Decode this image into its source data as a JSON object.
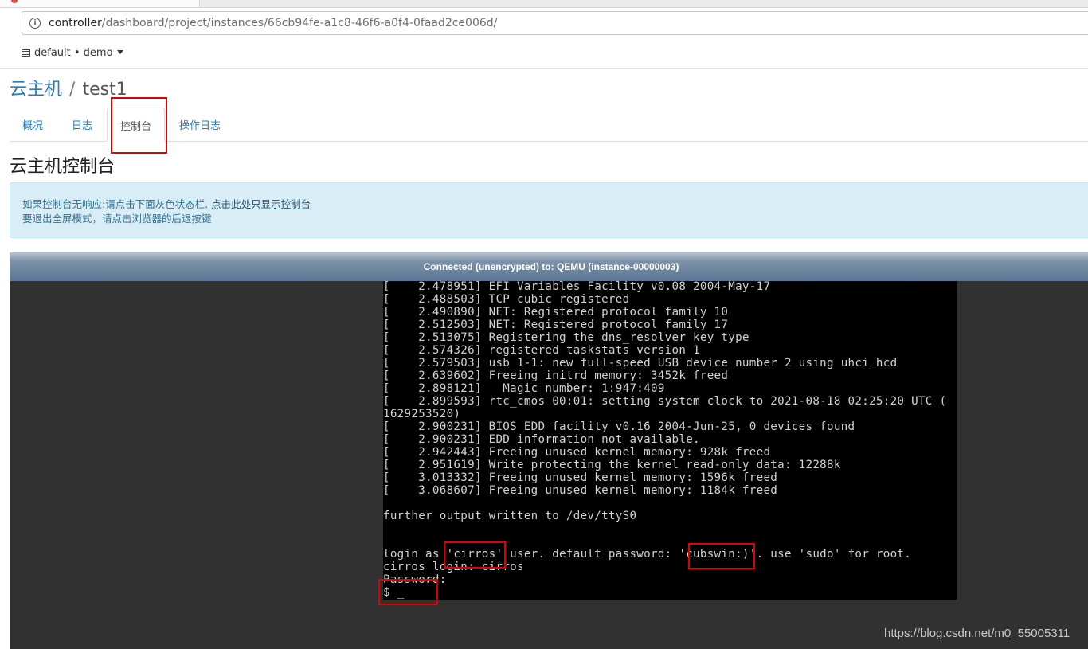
{
  "browser": {
    "url_host": "controller",
    "url_path": "/dashboard/project/instances/66cb94fe-a1c8-46f6-a0f4-0faad2ce006d/"
  },
  "nav": {
    "project_selector": "default • demo"
  },
  "breadcrumb": {
    "parent": "云主机",
    "separator": "/",
    "current": "test1"
  },
  "tabs": [
    {
      "label": "概况"
    },
    {
      "label": "日志"
    },
    {
      "label": "控制台",
      "active": true
    },
    {
      "label": "操作日志"
    }
  ],
  "page_title": "云主机控制台",
  "alert": {
    "line1_text": "如果控制台无响应:请点击下面灰色状态栏.",
    "line1_link": "点击此处只显示控制台",
    "line2_text": "要退出全屏模式，请点击浏览器的后退按键"
  },
  "console": {
    "status": "Connected (unencrypted) to: QEMU (instance-00000003)",
    "lines": [
      "[    2.478951] EFI Variables Facility v0.08 2004-May-17",
      "[    2.488503] TCP cubic registered",
      "[    2.490890] NET: Registered protocol family 10",
      "[    2.512503] NET: Registered protocol family 17",
      "[    2.513075] Registering the dns_resolver key type",
      "[    2.574326] registered taskstats version 1",
      "[    2.579503] usb 1-1: new full-speed USB device number 2 using uhci_hcd",
      "[    2.639602] Freeing initrd memory: 3452k freed",
      "[    2.898121]   Magic number: 1:947:409",
      "[    2.899593] rtc_cmos 00:01: setting system clock to 2021-08-18 02:25:20 UTC (",
      "1629253520)",
      "[    2.900231] BIOS EDD facility v0.16 2004-Jun-25, 0 devices found",
      "[    2.900231] EDD information not available.",
      "[    2.942443] Freeing unused kernel memory: 928k freed",
      "[    2.951619] Write protecting the kernel read-only data: 12288k",
      "[    3.013332] Freeing unused kernel memory: 1596k freed",
      "[    3.068607] Freeing unused kernel memory: 1184k freed",
      "",
      "further output written to /dev/ttyS0",
      "",
      "",
      "login as 'cirros' user. default password: 'cubswin:)'. use 'sudo' for root.",
      "cirros login: cirros",
      "Password:",
      "$ _"
    ]
  },
  "colors": {
    "link": "#2b7ab7",
    "alert_bg": "#d9edf7",
    "alert_text": "#31708f",
    "highlight": "#e00000",
    "terminal_bg": "#000000",
    "console_bg": "#313131"
  },
  "watermark": "https://blog.csdn.net/m0_55005311"
}
